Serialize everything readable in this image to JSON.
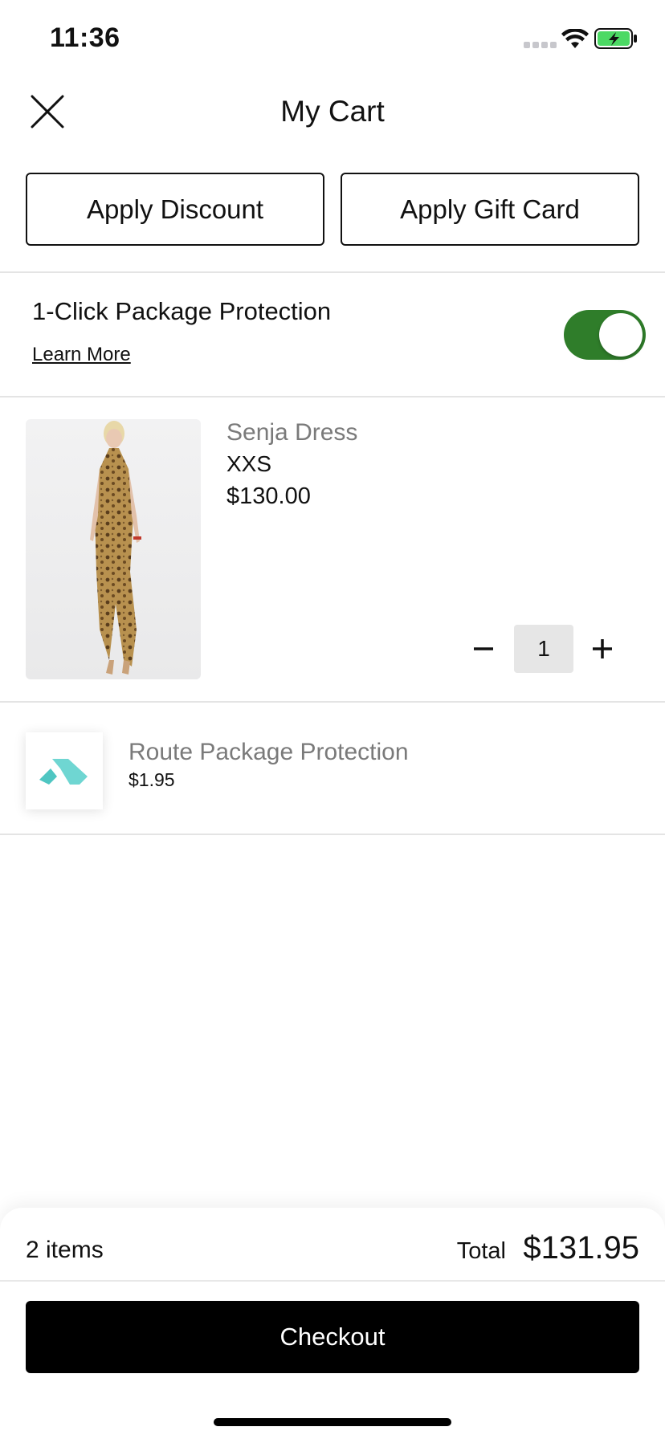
{
  "status_bar": {
    "time": "11:36"
  },
  "header": {
    "title": "My Cart"
  },
  "actions": {
    "discount_label": "Apply Discount",
    "gift_card_label": "Apply Gift Card"
  },
  "protection": {
    "title": "1-Click Package Protection",
    "learn_more": "Learn More",
    "enabled": true
  },
  "cart_items": [
    {
      "name": "Senja Dress",
      "size": "XXS",
      "price": "$130.00",
      "quantity": "1"
    }
  ],
  "route": {
    "name": "Route Package Protection",
    "price": "$1.95"
  },
  "summary": {
    "item_count": "2 items",
    "total_label": "Total",
    "total_value": "$131.95",
    "checkout_label": "Checkout"
  },
  "colors": {
    "toggle_on": "#2f7d2a",
    "route_teal": "#6fd6d2",
    "checkout_bg": "#000000"
  }
}
